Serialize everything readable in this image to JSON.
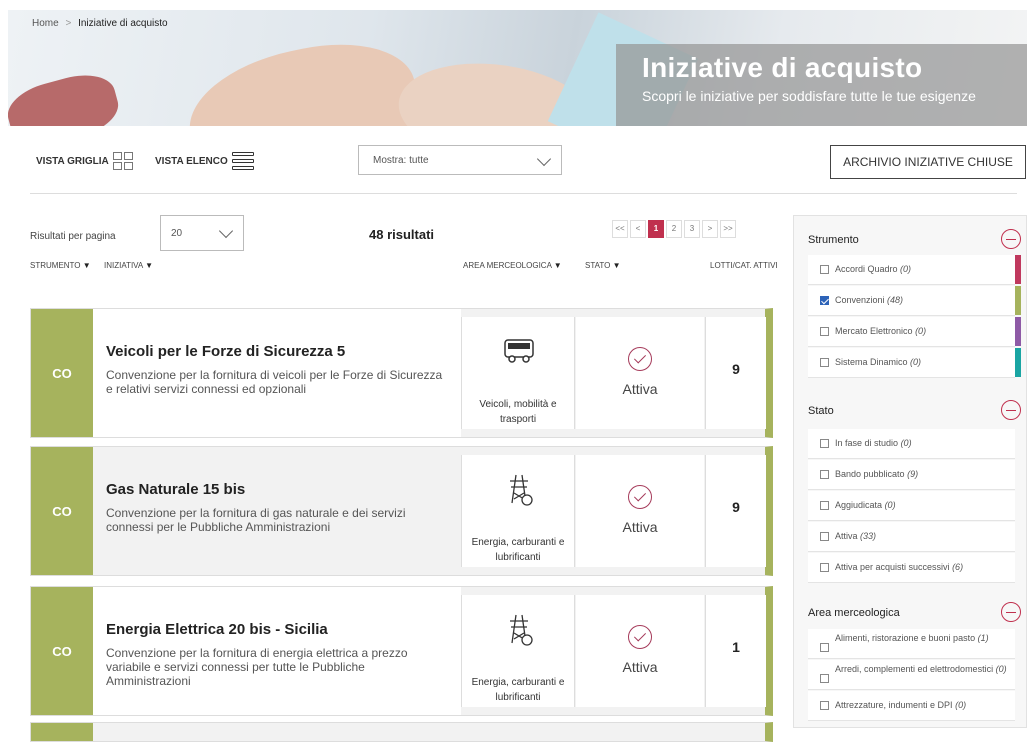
{
  "breadcrumb": {
    "home": "Home",
    "separator": ">",
    "current": "Iniziative di acquisto"
  },
  "hero": {
    "title": "Iniziative di acquisto",
    "subtitle": "Scopri le iniziative per soddisfare tutte le tue esigenze"
  },
  "toolbar": {
    "grid_view": "VISTA GRIGLIA",
    "list_view": "VISTA ELENCO",
    "show_select": "Mostra: tutte",
    "archive_button": "ARCHIVIO INIZIATIVE CHIUSE"
  },
  "results": {
    "per_page_label": "Risultati per pagina",
    "per_page_value": "20",
    "count": "48 risultati",
    "pagination": [
      "<<",
      "<",
      "1",
      "2",
      "3",
      ">",
      ">>"
    ],
    "current_page": "1"
  },
  "table_headers": {
    "strumento": "STRUMENTO",
    "iniziativa": "INIZIATIVA",
    "area": "AREA MERCEOLOGICA",
    "stato": "STATO",
    "lotti": "LOTTI/CAT. ATTIVI"
  },
  "rows": [
    {
      "code": "CO",
      "title": "Veicoli per le Forze di Sicurezza 5",
      "description": "Convenzione per la fornitura di veicoli per le Forze di Sicurezza e relativi servizi connessi ed opzionali",
      "area": "Veicoli, mobilità e trasporti",
      "area_icon": "bus-icon",
      "state": "Attiva",
      "lots": "9"
    },
    {
      "code": "CO",
      "title": "Gas Naturale 15 bis",
      "description": "Convenzione per la fornitura di gas naturale e dei servizi connessi per le Pubbliche Amministrazioni",
      "area": "Energia, carburanti e lubrificanti",
      "area_icon": "power-tower-icon",
      "state": "Attiva",
      "lots": "9"
    },
    {
      "code": "CO",
      "title": "Energia Elettrica 20 bis - Sicilia",
      "description": "Convenzione per la fornitura di energia elettrica a prezzo variabile e servizi connessi per tutte le Pubbliche Amministrazioni",
      "area": "Energia, carburanti e lubrificanti",
      "area_icon": "power-tower-icon",
      "state": "Attiva",
      "lots": "1"
    }
  ],
  "sidebar": {
    "strumento": {
      "title": "Strumento",
      "items": [
        {
          "label": "Accordi Quadro",
          "count": "(0)",
          "checked": false,
          "color": "#c0395e"
        },
        {
          "label": "Convenzioni",
          "count": "(48)",
          "checked": true,
          "color": "#a6b35d"
        },
        {
          "label": "Mercato Elettronico",
          "count": "(0)",
          "checked": false,
          "color": "#8e5aa6"
        },
        {
          "label": "Sistema Dinamico",
          "count": "(0)",
          "checked": false,
          "color": "#1aa5a3"
        }
      ]
    },
    "stato": {
      "title": "Stato",
      "items": [
        {
          "label": "In fase di studio",
          "count": "(0)"
        },
        {
          "label": "Bando pubblicato",
          "count": "(9)"
        },
        {
          "label": "Aggiudicata",
          "count": "(0)"
        },
        {
          "label": "Attiva",
          "count": "(33)"
        },
        {
          "label": "Attiva per acquisti successivi",
          "count": "(6)"
        }
      ]
    },
    "area": {
      "title": "Area merceologica",
      "items": [
        {
          "label": "Alimenti, ristorazione e buoni pasto",
          "count": "(1)"
        },
        {
          "label": "Arredi, complementi ed elettrodomestici",
          "count": "(0)"
        },
        {
          "label": "Attrezzature, indumenti e DPI",
          "count": "(0)"
        }
      ]
    }
  }
}
